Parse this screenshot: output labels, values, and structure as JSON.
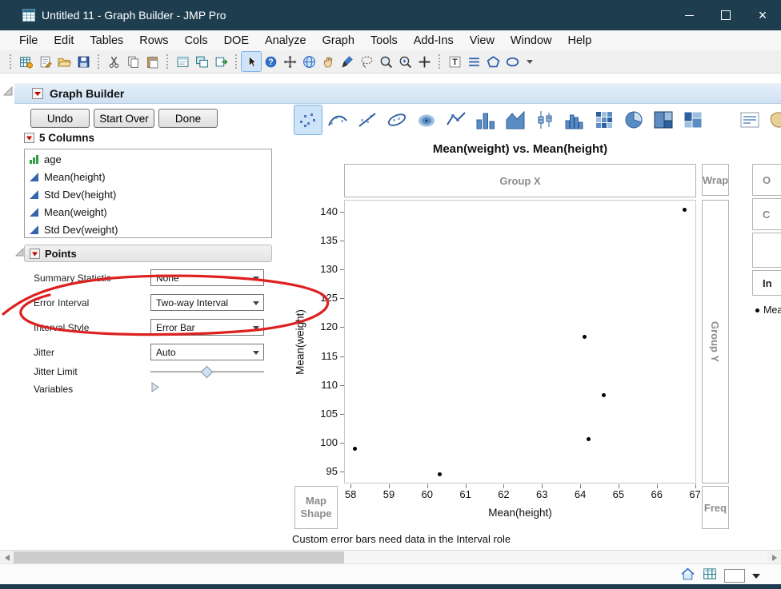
{
  "titlebar": {
    "title": "Untitled 11 - Graph Builder - JMP Pro",
    "icons": [
      "app-icon",
      "minimize-button",
      "maximize-button",
      "close-button"
    ]
  },
  "menu": {
    "items": [
      "File",
      "Edit",
      "Tables",
      "Rows",
      "Cols",
      "DOE",
      "Analyze",
      "Graph",
      "Tools",
      "Add-Ins",
      "View",
      "Window",
      "Help"
    ]
  },
  "toolbar": {
    "selected_icon": "arrow-cursor",
    "icons": [
      "new-data-table",
      "new-script",
      "open",
      "save",
      "cut",
      "copy",
      "paste",
      "new-journal",
      "window-layout",
      "export-window",
      "arrow-cursor",
      "help",
      "move",
      "globe",
      "grabber-hand",
      "brush",
      "lasso",
      "magnifier",
      "zoom",
      "crosshair",
      "annotate-text",
      "annotate-lines",
      "annotate-polygon",
      "annotate-oval",
      "toolbar-overflow"
    ]
  },
  "graph_builder": {
    "panel_title": "Graph Builder",
    "undo_label": "Undo",
    "start_over_label": "Start Over",
    "done_label": "Done",
    "selected_palette_icon": "points",
    "palette_icons": [
      "points",
      "smoother",
      "line-of-fit",
      "ellipse",
      "contour",
      "line",
      "bar",
      "area",
      "box-plot",
      "histogram",
      "heatmap",
      "pie",
      "treemap",
      "mosaic",
      "caption-box",
      "map-shapes"
    ],
    "columns_panel": {
      "title": "5 Columns",
      "items": [
        {
          "label": "age",
          "icon": "histogram"
        },
        {
          "label": "Mean(height)",
          "icon": "continuous"
        },
        {
          "label": "Std Dev(height)",
          "icon": "continuous"
        },
        {
          "label": "Mean(weight)",
          "icon": "continuous"
        },
        {
          "label": "Std Dev(weight)",
          "icon": "continuous"
        }
      ]
    },
    "points_panel": {
      "title": "Points",
      "dropdowns": [
        {
          "label": "Summary Statistic",
          "value": "None"
        },
        {
          "label": "Error Interval",
          "value": "Two-way Interval"
        },
        {
          "label": "Interval Style",
          "value": "Error Bar"
        },
        {
          "label": "Jitter",
          "value": "Auto"
        }
      ],
      "jitter_limit_label": "Jitter Limit",
      "jitter_limit_percent": 49,
      "variables_label": "Variables"
    },
    "zones": {
      "group_x": "Group X",
      "wrap": "Wrap",
      "group_y": "Group Y",
      "map_shape": "Map Shape",
      "freq": "Freq",
      "right_edge_clipped": [
        "O",
        "C",
        "",
        "In"
      ],
      "legend_item_clipped": "Mea"
    },
    "status_note": "Custom error bars need data in the Interval role"
  },
  "chart_data": {
    "type": "scatter",
    "title": "Mean(weight) vs. Mean(height)",
    "xlabel": "Mean(height)",
    "ylabel": "Mean(weight)",
    "xlim": [
      57.83,
      67.03
    ],
    "ylim": [
      92.9,
      142.1
    ],
    "xticks": [
      58,
      59,
      60,
      61,
      62,
      63,
      64,
      65,
      66,
      67
    ],
    "yticks": [
      95,
      100,
      105,
      110,
      115,
      120,
      125,
      130,
      135,
      140
    ],
    "grid": false,
    "legend_position": "right",
    "marker_color": "#000000",
    "points": [
      {
        "x": 58.1,
        "y": 99.0
      },
      {
        "x": 60.3,
        "y": 94.7
      },
      {
        "x": 64.1,
        "y": 118.5
      },
      {
        "x": 64.2,
        "y": 100.7
      },
      {
        "x": 64.6,
        "y": 108.4
      },
      {
        "x": 66.7,
        "y": 140.5
      }
    ]
  },
  "annotation": {
    "shape": "hand-drawn-ellipse",
    "color": "#dd2020",
    "around": "Error Interval"
  },
  "statusbar": {
    "icons": [
      "home",
      "data-table-grid",
      "window-box",
      "dropdown-arrow"
    ]
  }
}
